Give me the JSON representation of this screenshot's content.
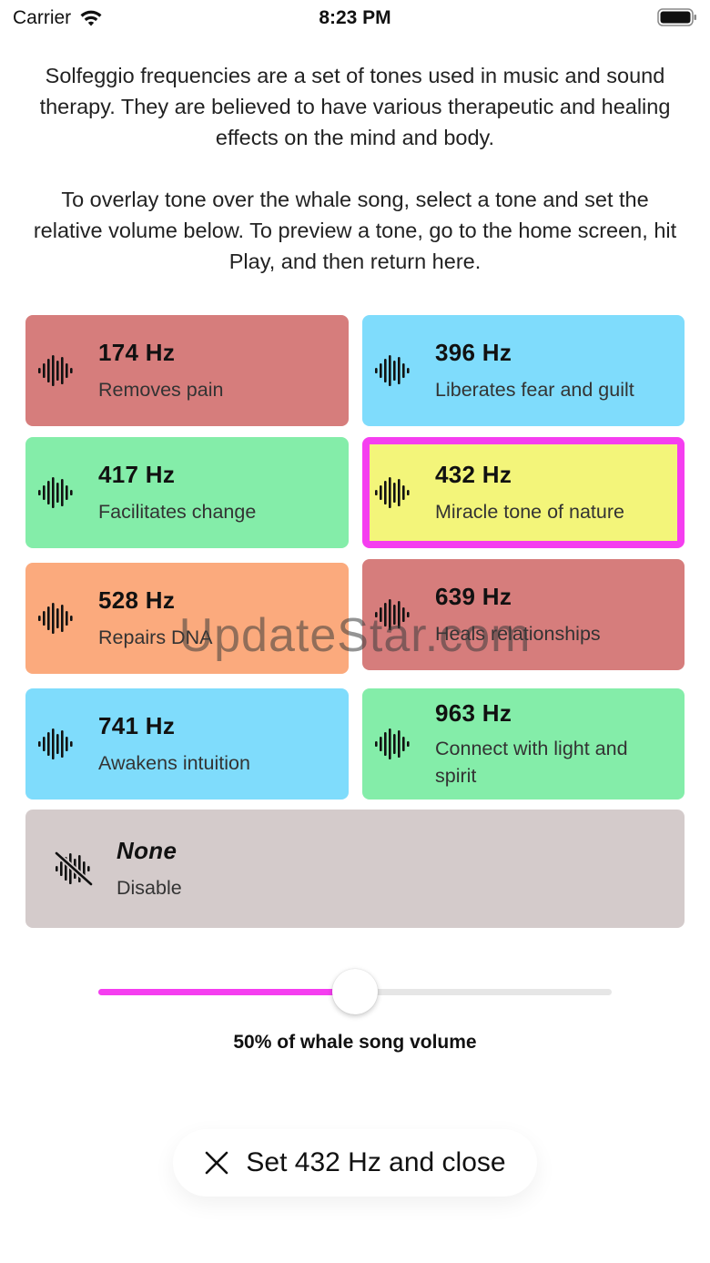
{
  "status_bar": {
    "carrier": "Carrier",
    "time": "8:23 PM"
  },
  "intro": {
    "paragraph_1": "Solfeggio frequencies are a set of tones used in music and sound therapy. They are believed to have various therapeutic and healing effects on the mind and body.",
    "paragraph_2": "To overlay tone over the whale song, select a tone and set the relative volume below. To preview a tone, go to the home screen, hit Play, and then return here."
  },
  "tones": [
    {
      "hz": "174 Hz",
      "desc": "Removes pain",
      "color": "#d67d7c"
    },
    {
      "hz": "396 Hz",
      "desc": "Liberates fear and guilt",
      "color": "#7fdcfc"
    },
    {
      "hz": "417 Hz",
      "desc": "Facilitates change",
      "color": "#84eda9"
    },
    {
      "hz": "432 Hz",
      "desc": "Miracle tone of nature",
      "color": "#f3f57a",
      "selected": true
    },
    {
      "hz": "528 Hz",
      "desc": "Repairs DNA",
      "color": "#fbaa7d"
    },
    {
      "hz": "639 Hz",
      "desc": "Heals relationships",
      "color": "#d67d7c"
    },
    {
      "hz": "741 Hz",
      "desc": "Awakens intuition",
      "color": "#7fdcfc"
    },
    {
      "hz": "963 Hz",
      "desc": "Connect with light and spirit",
      "color": "#84eda9"
    }
  ],
  "none_option": {
    "title": "None",
    "desc": "Disable",
    "color": "#d4cbcb"
  },
  "watermark": "UpdateStar.com",
  "slider": {
    "value_percent": 50,
    "label": "50% of whale song volume",
    "accent_color": "#f53ef0"
  },
  "close_button": {
    "label": "Set 432 Hz and close"
  },
  "icons": {
    "tone": "waveform-icon",
    "none": "waveform-slash-icon",
    "close": "close-icon"
  }
}
